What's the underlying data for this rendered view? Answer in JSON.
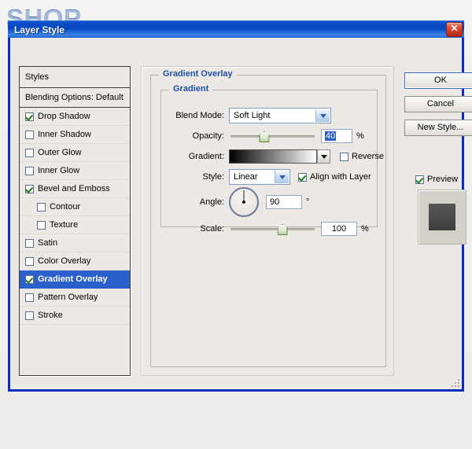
{
  "page": {
    "heading": "SHOP"
  },
  "dialog": {
    "title": "Layer Style",
    "close_label": "✕",
    "close_icon": "close-icon"
  },
  "styles_panel": {
    "header": "Styles",
    "blending_options": "Blending Options: Default",
    "effects": [
      {
        "label": "Drop Shadow",
        "checked": true,
        "indent": false,
        "selected": false
      },
      {
        "label": "Inner Shadow",
        "checked": false,
        "indent": false,
        "selected": false
      },
      {
        "label": "Outer Glow",
        "checked": false,
        "indent": false,
        "selected": false
      },
      {
        "label": "Inner Glow",
        "checked": false,
        "indent": false,
        "selected": false
      },
      {
        "label": "Bevel and Emboss",
        "checked": true,
        "indent": false,
        "selected": false
      },
      {
        "label": "Contour",
        "checked": false,
        "indent": true,
        "selected": false
      },
      {
        "label": "Texture",
        "checked": false,
        "indent": true,
        "selected": false
      },
      {
        "label": "Satin",
        "checked": false,
        "indent": false,
        "selected": false
      },
      {
        "label": "Color Overlay",
        "checked": false,
        "indent": false,
        "selected": false
      },
      {
        "label": "Gradient Overlay",
        "checked": true,
        "indent": false,
        "selected": true
      },
      {
        "label": "Pattern Overlay",
        "checked": false,
        "indent": false,
        "selected": false
      },
      {
        "label": "Stroke",
        "checked": false,
        "indent": false,
        "selected": false
      }
    ]
  },
  "settings": {
    "outer_group_title": "Gradient Overlay",
    "inner_group_title": "Gradient",
    "blend_mode": {
      "label": "Blend Mode:",
      "value": "Soft Light"
    },
    "opacity": {
      "label": "Opacity:",
      "value": "40",
      "unit": "%",
      "percent": 40
    },
    "gradient": {
      "label": "Gradient:",
      "start_color": "#000000",
      "end_color": "#ffffff",
      "reverse_label": "Reverse",
      "reverse_checked": false
    },
    "style": {
      "label": "Style:",
      "value": "Linear",
      "align_label": "Align with Layer",
      "align_checked": true
    },
    "angle": {
      "label": "Angle:",
      "value": "90",
      "unit": "°"
    },
    "scale": {
      "label": "Scale:",
      "value": "100",
      "unit": "%",
      "percent": 100
    }
  },
  "actions": {
    "ok": "OK",
    "cancel": "Cancel",
    "new_style": "New Style...",
    "preview_label": "Preview",
    "preview_checked": true
  },
  "colors": {
    "title_blue": "#0746c2",
    "dialog_border": "#0a2fc0",
    "group_title": "#1d4fa3",
    "selection": "#2a5fcc",
    "check_green": "#1f7a1f"
  }
}
